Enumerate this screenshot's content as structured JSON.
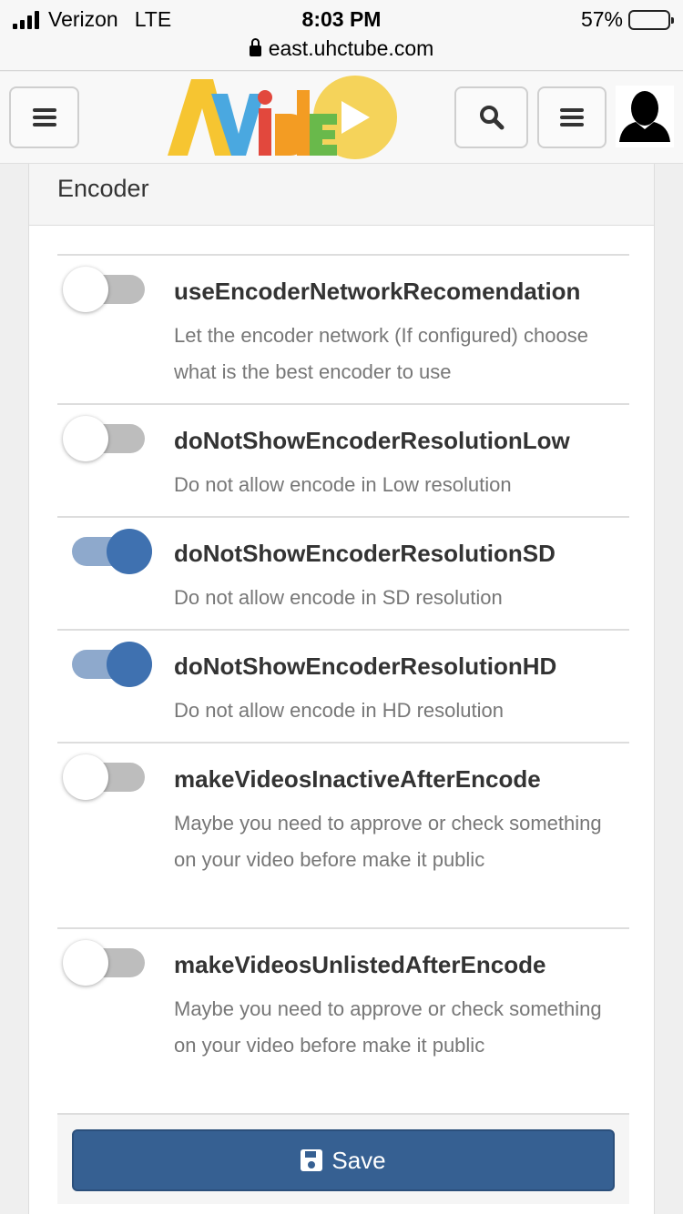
{
  "status_bar": {
    "carrier": "Verizon",
    "network": "LTE",
    "time": "8:03 PM",
    "battery_label": "57%",
    "battery_level": 0.57
  },
  "browser": {
    "url": "east.uhctube.com"
  },
  "header": {
    "logo_text": "AVideo"
  },
  "panel": {
    "title": "Encoder",
    "settings": [
      {
        "name": "useEncoderNetworkRecomendation",
        "description": "Let the encoder network (If configured) choose what is the best encoder to use",
        "enabled": false
      },
      {
        "name": "doNotShowEncoderResolutionLow",
        "description": "Do not allow encode in Low resolution",
        "enabled": false
      },
      {
        "name": "doNotShowEncoderResolutionSD",
        "description": "Do not allow encode in SD resolution",
        "enabled": true
      },
      {
        "name": "doNotShowEncoderResolutionHD",
        "description": "Do not allow encode in HD resolution",
        "enabled": true
      },
      {
        "name": "makeVideosInactiveAfterEncode",
        "description": "Maybe you need to approve or check something on your video before make it public",
        "enabled": false
      },
      {
        "name": "makeVideosUnlistedAfterEncode",
        "description": "Maybe you need to approve or check something on your video before make it public",
        "enabled": false
      }
    ],
    "save_label": "Save"
  },
  "colors": {
    "primary": "#366092",
    "toggle_on": "#3f71b0",
    "toggle_off_track": "#bdbdbd"
  },
  "icons": [
    "signal-icon",
    "lock-icon",
    "battery-icon",
    "menu-icon",
    "search-icon",
    "user-avatar-icon",
    "save-icon"
  ]
}
